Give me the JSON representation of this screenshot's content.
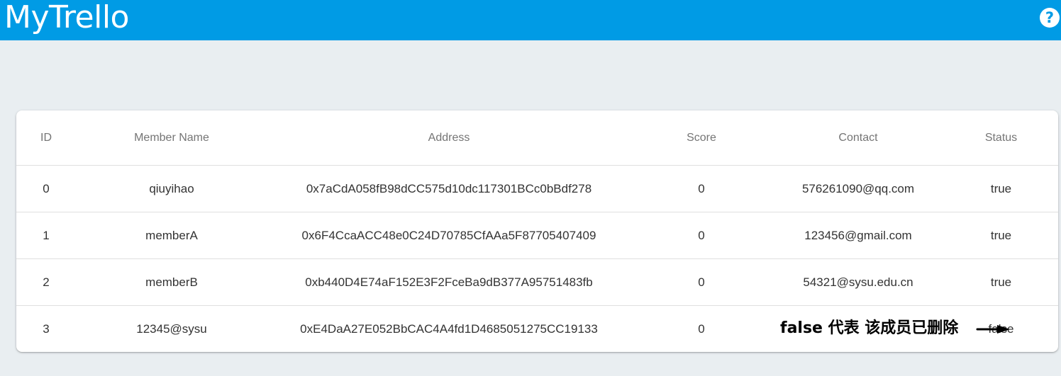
{
  "app": {
    "title": "MyTrello",
    "help_icon": "help-circle-icon",
    "help_glyph": "?",
    "header_color": "#009be5"
  },
  "table": {
    "headers": {
      "id": "ID",
      "name": "Member Name",
      "address": "Address",
      "score": "Score",
      "contact": "Contact",
      "status": "Status"
    },
    "rows": [
      {
        "id": "0",
        "name": "qiuyihao",
        "address": "0x7aCdA058fB98dCC575d10dc117301BCc0bBdf278",
        "score": "0",
        "contact": "576261090@qq.com",
        "status": "true"
      },
      {
        "id": "1",
        "name": "memberA",
        "address": "0x6F4CcaACC48e0C24D70785CfAAa5F87705407409",
        "score": "0",
        "contact": "123456@gmail.com",
        "status": "true"
      },
      {
        "id": "2",
        "name": "memberB",
        "address": "0xb440D4E74aF152E3F2FceBa9dB377A95751483fb",
        "score": "0",
        "contact": "54321@sysu.edu.cn",
        "status": "true"
      },
      {
        "id": "3",
        "name": "12345@sysu",
        "address": "0xE4DaA27E052BbCAC4A4fd1D4685051275CC19133",
        "score": "0",
        "contact": "",
        "status": "false"
      }
    ]
  },
  "annotation": {
    "text": "false 代表 该成员已删除",
    "arrow_icon": "arrow-right-icon"
  }
}
